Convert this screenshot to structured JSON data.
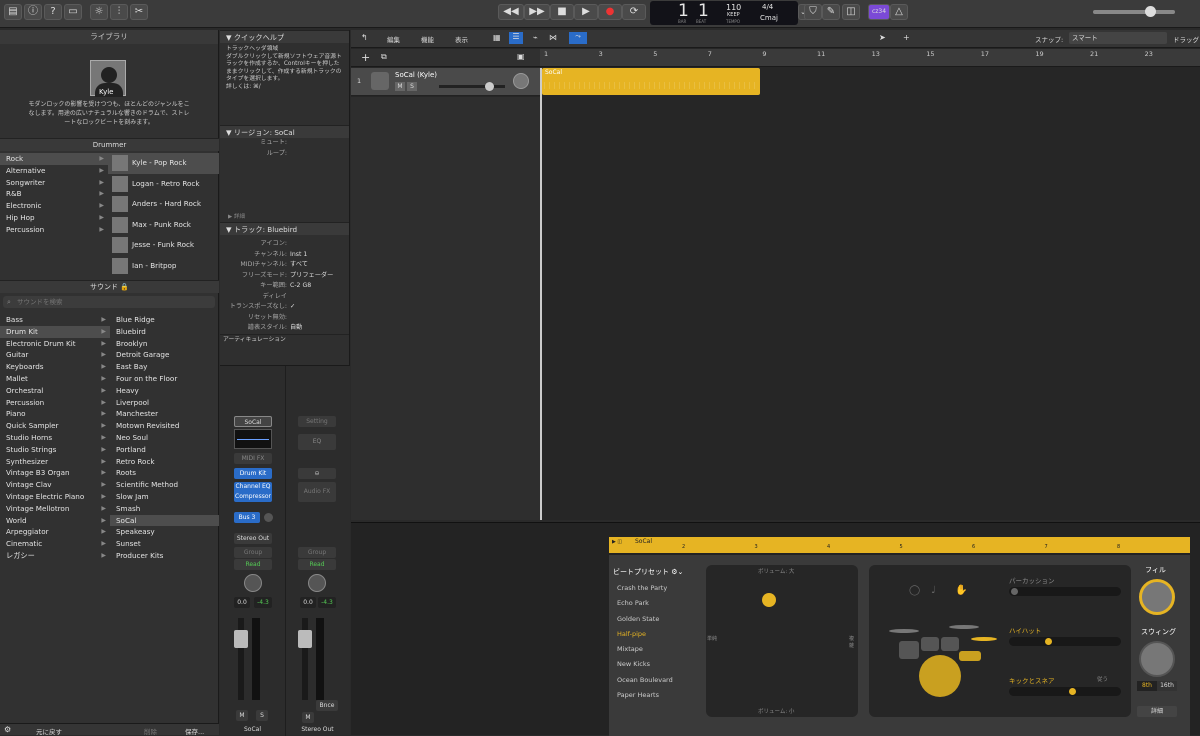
{
  "transport": {
    "bar": "1",
    "beat": "1",
    "bar_label": "BAR",
    "beat_label": "BEAT",
    "tempo": "110",
    "keep": "KEEP",
    "tempo_label": "TEMPO",
    "time_sig": "4/4",
    "key": "Cmaj",
    "user_badge": "cz34"
  },
  "library": {
    "title": "ライブラリ",
    "description": "モダンロックの影響を受けつつも、ほとんどのジャンルをこなします。用途の広いナチュラルな響きのドラムで、ストレートなロックビートを刻みます。",
    "avatar_label": "Kyle",
    "drummer_header": "Drummer",
    "genres": [
      "Rock",
      "Alternative",
      "Songwriter",
      "R&B",
      "Electronic",
      "Hip Hop",
      "Percussion"
    ],
    "drummers": [
      "Kyle - Pop Rock",
      "Logan - Retro Rock",
      "Anders - Hard Rock",
      "Max - Punk Rock",
      "Jesse - Funk Rock",
      "Ian - Britpop"
    ],
    "sound_header": "サウンド",
    "search_placeholder": "サウンドを検索",
    "sound_categories": [
      "Bass",
      "Drum Kit",
      "Electronic Drum Kit",
      "Guitar",
      "Keyboards",
      "Mallet",
      "Orchestral",
      "Percussion",
      "Piano",
      "Quick Sampler",
      "Studio Horns",
      "Studio Strings",
      "Synthesizer",
      "Vintage B3 Organ",
      "Vintage Clav",
      "Vintage Electric Piano",
      "Vintage Mellotron",
      "World",
      "Arpeggiator",
      "Cinematic",
      "レガシー"
    ],
    "sounds": [
      "Blue Ridge",
      "Bluebird",
      "Brooklyn",
      "Detroit Garage",
      "East Bay",
      "Four on the Floor",
      "Heavy",
      "Liverpool",
      "Manchester",
      "Motown Revisited",
      "Neo Soul",
      "Portland",
      "Retro Rock",
      "Roots",
      "Scientific Method",
      "Slow Jam",
      "Smash",
      "SoCal",
      "Speakeasy",
      "Sunset",
      "Producer Kits"
    ],
    "footer": {
      "revert": "元に戻す",
      "delete": "削除",
      "save": "保存..."
    }
  },
  "inspector": {
    "quick_help_title": "クイックヘルプ",
    "quick_help_heading": "トラックヘッダ領域",
    "quick_help_body": "ダブルクリックして新規ソフトウェア音源トラックを作成するか、Controlキーを押したままクリックして、作成する新規トラックのタイプを選択します。",
    "quick_help_more": "詳しくは: ⌘/",
    "region_title": "リージョン: SoCal",
    "region_mute": "ミュート:",
    "region_loop": "ループ:",
    "details": "詳細",
    "track_title": "トラック: Bluebird",
    "track_rows": [
      {
        "k": "アイコン:",
        "v": ""
      },
      {
        "k": "チャンネル:",
        "v": "Inst 1"
      },
      {
        "k": "MIDIチャンネル:",
        "v": "すべて"
      },
      {
        "k": "フリーズモード:",
        "v": "プリフェーダー"
      },
      {
        "k": "キー範囲:",
        "v": "C-2  G8"
      },
      {
        "k": "ディレイ",
        "v": ""
      },
      {
        "k": "トランスポーズなし:",
        "v": "✓"
      },
      {
        "k": "リセット無効:",
        "v": ""
      },
      {
        "k": "譜表スタイル:",
        "v": "自動"
      }
    ],
    "articulation": "アーティキュレーション"
  },
  "mixer": {
    "strip1": {
      "setting": "SoCal",
      "midi_fx": "MIDI FX",
      "inst": "Drum Kit",
      "fx": "Channel EQ Compressor",
      "send": "Bus 3",
      "output": "Stereo Out",
      "group": "Group",
      "read": "Read",
      "vol": "0.0",
      "peak": "-4.3",
      "name": "SoCal"
    },
    "strip2": {
      "setting": "Setting",
      "eq": "EQ",
      "audio_fx": "Audio FX",
      "group": "Group",
      "read": "Read",
      "vol": "0.0",
      "peak": "-4.3",
      "bnce": "Bnce",
      "name": "Stereo Out"
    },
    "mute": "M",
    "solo": "S"
  },
  "tracks": {
    "toolbar": {
      "edit": "編集",
      "function": "機能",
      "view": "表示",
      "snap_label": "スナップ:",
      "snap_value": "スマート",
      "drag_label": "ドラッグ"
    },
    "ruler": [
      "1",
      "3",
      "5",
      "7",
      "9",
      "11",
      "13",
      "15",
      "17",
      "19",
      "21",
      "23"
    ],
    "track_name": "SoCal (Kyle)",
    "track_number": "1",
    "region_name": "SoCal"
  },
  "drummer_editor": {
    "region_name": "SoCal",
    "ruler": [
      "2",
      "3",
      "4",
      "5",
      "6",
      "7",
      "8"
    ],
    "preset_header": "ビートプリセット",
    "presets": [
      "Crash the Party",
      "Echo Park",
      "Golden State",
      "Half-pipe",
      "Mixtape",
      "New Kicks",
      "Ocean Boulevard",
      "Paper Hearts"
    ],
    "selected_preset": "Half-pipe",
    "xy_top": "ボリューム: 大",
    "xy_bottom": "ボリューム: 小",
    "xy_left": "単純",
    "xy_right": "複雑",
    "percussion": "パーカッション",
    "hihat": "ハイハット",
    "kick_snare": "キックとスネア",
    "follow": "従う",
    "fill": "フィル",
    "swing": "スウィング",
    "eighth": "8th",
    "sixteenth": "16th",
    "details": "詳細",
    "accent_color": "#e6b423"
  }
}
